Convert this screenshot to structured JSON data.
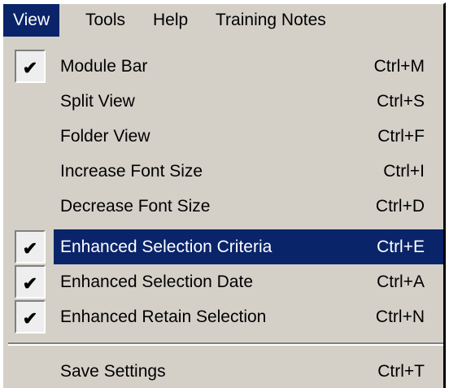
{
  "menubar": {
    "items": [
      {
        "label": "View"
      },
      {
        "label": "Tools"
      },
      {
        "label": "Help"
      },
      {
        "label": "Training Notes"
      }
    ]
  },
  "view_menu": {
    "items": [
      {
        "label": "Module Bar",
        "shortcut": "Ctrl+M",
        "checked": true,
        "highlighted": false
      },
      {
        "label": "Split View",
        "shortcut": "Ctrl+S",
        "checked": false,
        "highlighted": false
      },
      {
        "label": "Folder View",
        "shortcut": "Ctrl+F",
        "checked": false,
        "highlighted": false
      },
      {
        "label": "Increase Font Size",
        "shortcut": "Ctrl+I",
        "checked": false,
        "highlighted": false
      },
      {
        "label": "Decrease Font Size",
        "shortcut": "Ctrl+D",
        "checked": false,
        "highlighted": false
      },
      {
        "label": "Enhanced Selection Criteria",
        "shortcut": "Ctrl+E",
        "checked": true,
        "highlighted": true
      },
      {
        "label": "Enhanced Selection Date",
        "shortcut": "Ctrl+A",
        "checked": true,
        "highlighted": false
      },
      {
        "label": "Enhanced Retain Selection",
        "shortcut": "Ctrl+N",
        "checked": true,
        "highlighted": false
      },
      {
        "label": "Save Settings",
        "shortcut": "Ctrl+T",
        "checked": false,
        "highlighted": false
      }
    ],
    "check_glyph": "✔"
  },
  "colors": {
    "menu_bg": "#d4d0c8",
    "highlight_bg": "#0a246a",
    "highlight_text": "#ffffff"
  }
}
